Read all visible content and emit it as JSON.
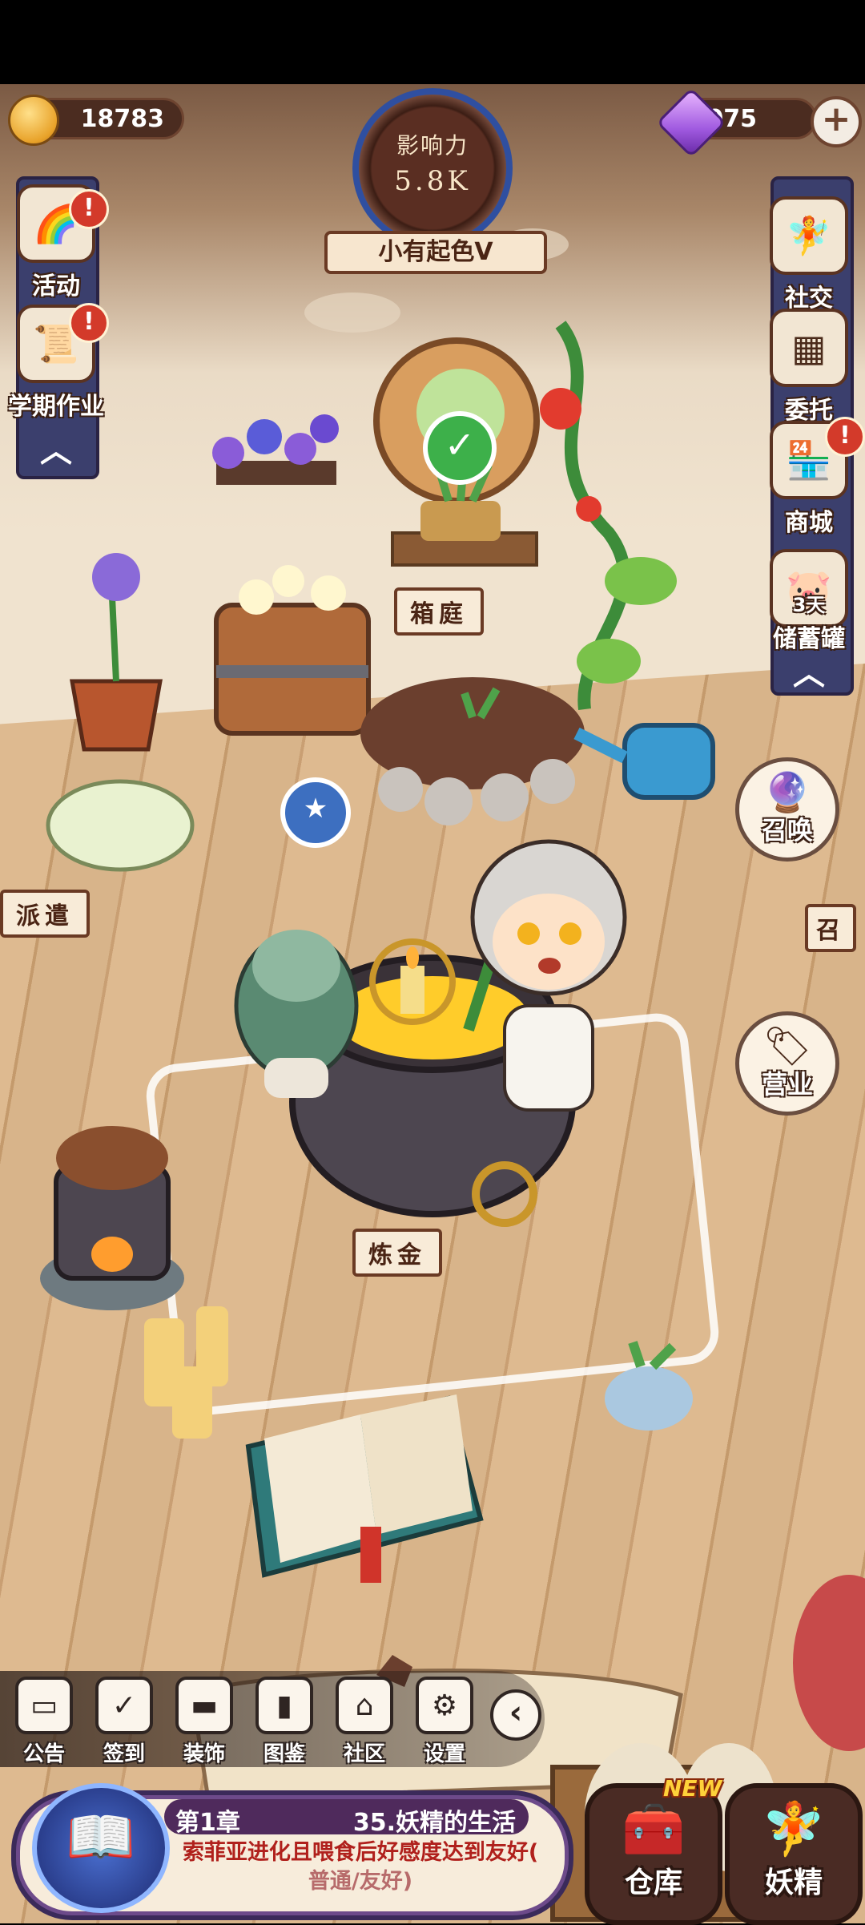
{
  "resources": {
    "coins": "18783",
    "gems": "2075"
  },
  "influence": {
    "label": "影响力",
    "value": "5.8K",
    "rank": "小有起色V"
  },
  "left_menu": [
    {
      "label": "活动",
      "icon": "rainbow-card-icon"
    },
    {
      "label": "学期作业",
      "icon": "scroll-icon"
    }
  ],
  "right_menu": [
    {
      "label": "社交",
      "icon": "fairies-icon"
    },
    {
      "label": "委托",
      "icon": "qr-board-icon"
    },
    {
      "label": "商城",
      "icon": "shop-icon"
    },
    {
      "label": "储蓄罐",
      "badge": "3天",
      "icon": "piggy-bank-icon"
    }
  ],
  "scene_labels": {
    "garden": "箱庭",
    "alchemy": "炼金",
    "dispatch": "派遣",
    "summon_edge": "召"
  },
  "round_buttons": {
    "summon": "召唤",
    "business": "营业"
  },
  "toolbar": [
    {
      "label": "公告",
      "icon": "notice-icon"
    },
    {
      "label": "签到",
      "icon": "calendar-check-icon"
    },
    {
      "label": "装饰",
      "icon": "paint-roller-icon"
    },
    {
      "label": "图鉴",
      "icon": "book-icon"
    },
    {
      "label": "社区",
      "icon": "home-icon"
    },
    {
      "label": "设置",
      "icon": "gear-icon"
    }
  ],
  "quest": {
    "chapter": "第1章",
    "title": "35.妖精的生活",
    "description": "索菲亚进化且喂食后好感度达到友好(",
    "description_sub": "普通/友好)"
  },
  "bottom_buttons": {
    "warehouse": "仓库",
    "warehouse_tag": "NEW",
    "fairy": "妖精"
  },
  "colors": {
    "alert_red": "#d33a2a",
    "banner_navy": "#3b3f6d",
    "quest_purple": "#4f2a5c"
  }
}
